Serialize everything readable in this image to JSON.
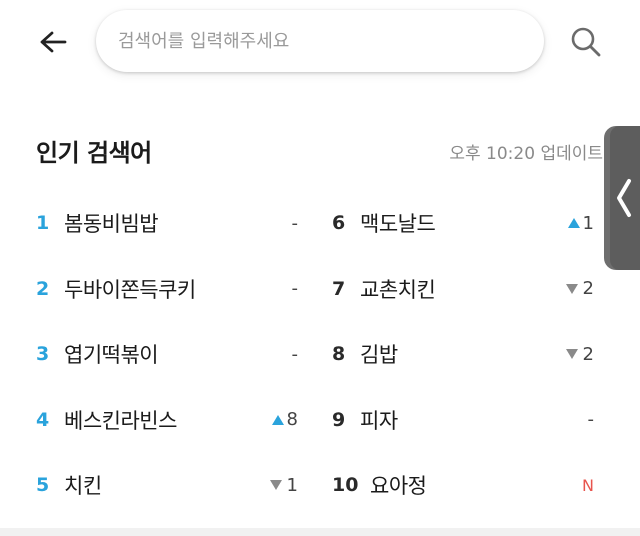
{
  "header": {
    "search_placeholder": "검색어를 입력해주세요",
    "back_icon": "arrow-left-icon",
    "search_icon": "search-icon"
  },
  "section": {
    "title": "인기 검색어",
    "update_time": "오후 10:20 업데이트"
  },
  "rankings": [
    {
      "rank": "1",
      "keyword": "봄동비빔밥",
      "change_type": "same",
      "change": "-"
    },
    {
      "rank": "2",
      "keyword": "두바이쫀득쿠키",
      "change_type": "same",
      "change": "-"
    },
    {
      "rank": "3",
      "keyword": "엽기떡볶이",
      "change_type": "same",
      "change": "-"
    },
    {
      "rank": "4",
      "keyword": "베스킨라빈스",
      "change_type": "up",
      "change": "8"
    },
    {
      "rank": "5",
      "keyword": "치킨",
      "change_type": "down",
      "change": "1"
    },
    {
      "rank": "6",
      "keyword": "맥도날드",
      "change_type": "up",
      "change": "1"
    },
    {
      "rank": "7",
      "keyword": "교촌치킨",
      "change_type": "down",
      "change": "2"
    },
    {
      "rank": "8",
      "keyword": "김밥",
      "change_type": "down",
      "change": "2"
    },
    {
      "rank": "9",
      "keyword": "피자",
      "change_type": "same",
      "change": "-"
    },
    {
      "rank": "10",
      "keyword": "요아정",
      "change_type": "new",
      "change": "N"
    }
  ],
  "colors": {
    "accent": "#2aa3dc",
    "down": "#8a8a8a",
    "new": "#e8554e"
  },
  "edge_panel": {
    "icon": "chevron-left-icon"
  }
}
